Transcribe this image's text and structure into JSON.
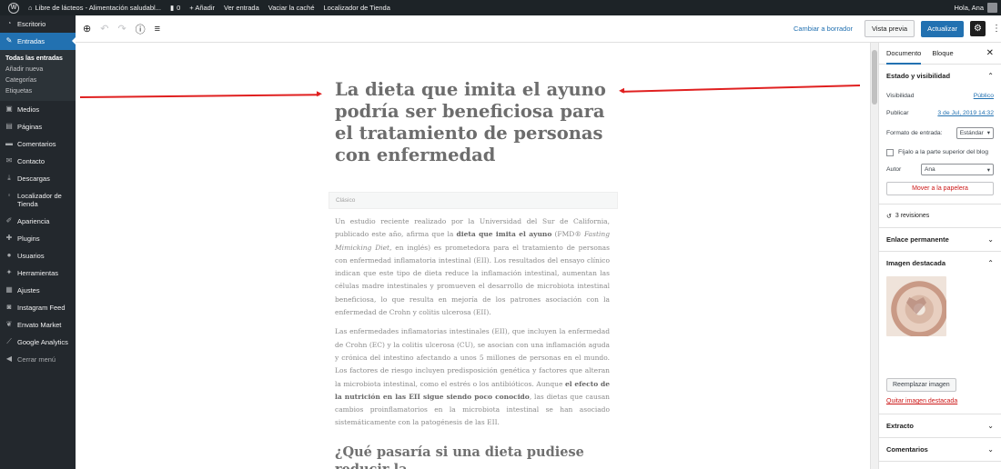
{
  "adminbar": {
    "site": "Libre de lácteos - Alimentación saludabl...",
    "comments": "0",
    "add": "+ Añadir",
    "view": "Ver entrada",
    "cache": "Vaciar la caché",
    "store": "Localizador de Tienda",
    "howdy": "Hola, Ana"
  },
  "sidebar": {
    "items": [
      {
        "label": "Escritorio",
        "icon": "dashboard-icon"
      },
      {
        "label": "Entradas",
        "icon": "pin-icon"
      },
      {
        "label": "Medios",
        "icon": "media-icon"
      },
      {
        "label": "Páginas",
        "icon": "pages-icon"
      },
      {
        "label": "Comentarios",
        "icon": "comments-icon"
      },
      {
        "label": "Contacto",
        "icon": "mail-icon"
      },
      {
        "label": "Descargas",
        "icon": "download-icon"
      },
      {
        "label": "Localizador de Tienda",
        "icon": "location-icon"
      },
      {
        "label": "Apariencia",
        "icon": "brush-icon"
      },
      {
        "label": "Plugins",
        "icon": "plugin-icon"
      },
      {
        "label": "Usuarios",
        "icon": "users-icon"
      },
      {
        "label": "Herramientas",
        "icon": "tools-icon"
      },
      {
        "label": "Ajustes",
        "icon": "settings-icon"
      },
      {
        "label": "Instagram Feed",
        "icon": "instagram-icon"
      },
      {
        "label": "Envato Market",
        "icon": "leaf-icon"
      },
      {
        "label": "Google Analytics",
        "icon": "chart-icon"
      },
      {
        "label": "Cerrar menú",
        "icon": "collapse-icon"
      }
    ],
    "sub": [
      "Todas las entradas",
      "Añadir nueva",
      "Categorías",
      "Etiquetas"
    ]
  },
  "toolbar": {
    "draft": "Cambiar a borrador",
    "preview": "Vista previa",
    "update": "Actualizar"
  },
  "post": {
    "title": "La dieta que imita el ayuno podría ser beneficiosa para el tratamiento de personas con enfermedad",
    "classic": "Clásico",
    "p1_a": "Un estudio reciente realizado por la Universidad del Sur de California, publicado este año, afirma que la ",
    "p1_b": "dieta que imita el ayuno",
    "p1_c": " (FMD® ",
    "p1_d": "Fasting Mimicking Diet",
    "p1_e": ", en inglés) es prometedora para el tratamiento de personas con enfermedad inflamatoria intestinal (EII). Los resultados del ensayo clínico indican que este tipo de dieta reduce la inflamación intestinal, aumentan las células madre intestinales y promueven el desarrollo de microbiota intestinal beneficiosa, lo que resulta en mejoría de los patrones asociación con la enfermedad de Crohn y colitis ulcerosa (EII).",
    "p2_a": "Las enfermedades inflamatorias intestinales (EII), que incluyen la enfermedad de Crohn (EC) y la colitis ulcerosa (CU), se asocian con una inflamación aguda y crónica del intestino afectando a unos 5 millones de personas en el mundo. Los factores de riesgo incluyen predisposición genética y factores que alteran la microbiota intestinal, como el estrés o los antibióticos. Aunque ",
    "p2_b": "el efecto de la nutrición en las EII sigue siendo poco conocido",
    "p2_c": ", las dietas que causan cambios proinflamatorios en la microbiota intestinal se han asociado sistemáticamente con la patogénesis de las EII.",
    "h2": "¿Qué pasaría si una dieta pudiese reducir la"
  },
  "panel": {
    "tab_doc": "Documento",
    "tab_block": "Bloque",
    "status_title": "Estado y visibilidad",
    "visibility_label": "Visibilidad",
    "visibility_value": "Público",
    "publish_label": "Publicar",
    "publish_value": "3 de Jul, 2019 14:32",
    "format_label": "Formato de entrada:",
    "format_value": "Estándar",
    "sticky": "Fíjalo a la parte superior del blog",
    "author_label": "Autor",
    "author_value": "Ana",
    "trash": "Mover a la papelera",
    "revisions": "3 revisiones",
    "permalink": "Enlace permanente",
    "featured": "Imagen destacada",
    "replace": "Reemplazar imagen",
    "remove": "Quitar imagen destacada",
    "excerpt": "Extracto",
    "comments": "Comentarios"
  },
  "colors": {
    "accent": "#2271b1",
    "annotation": "#e02020",
    "danger": "#cc1818"
  }
}
